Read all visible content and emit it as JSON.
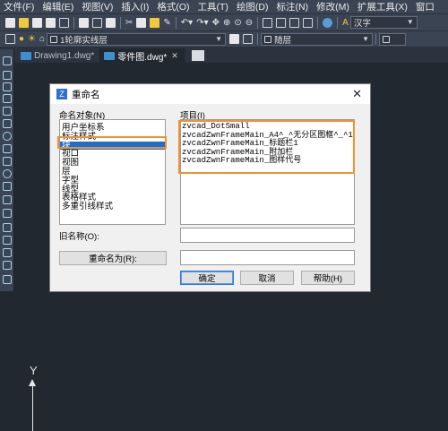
{
  "menu": [
    "文件(F)",
    "编辑(E)",
    "视图(V)",
    "插入(I)",
    "格式(O)",
    "工具(T)",
    "绘图(D)",
    "标注(N)",
    "修改(M)",
    "扩展工具(X)",
    "窗口"
  ],
  "toolbar": {
    "font_combo": "汉字",
    "layer_combo": "1轮廓实线层",
    "layer_right_combo": "随层"
  },
  "tabs": [
    {
      "label": "Drawing1.dwg*",
      "active": false
    },
    {
      "label": "零件图.dwg*",
      "active": true
    }
  ],
  "dialog": {
    "title": "重命名",
    "objects_label": "命名对象(N)",
    "items_label": "项目(I)",
    "named_objects": [
      "用户坐标系",
      "标注样式",
      "块",
      "视口",
      "视图",
      "层",
      "字型",
      "线型",
      "表格样式",
      "多重引线样式"
    ],
    "selected_object": "块",
    "items": [
      "zvcad_DotSmall",
      "zvcadZwnFrameMain_A4^_^无分区图框^_^1",
      "zvcadZwnFrameMain_标题栏1",
      "zvcadZwnFrameMain_附加栏",
      "zvcadZwnFrameMain_图样代号"
    ],
    "old_name_label": "旧名称(O):",
    "rename_to_button": "重命名为(R):",
    "ok_button": "确定",
    "cancel_button": "取消",
    "help_button": "帮助(H)",
    "highlight_color": "#f39130",
    "selection_color": "#1f6fd1"
  },
  "ucs": {
    "y_label": "Y"
  },
  "icons": [
    "new-icon",
    "open-icon",
    "save-icon",
    "print-icon",
    "cut-icon",
    "copy-icon",
    "paste-icon",
    "undo-icon",
    "redo-icon",
    "pan-icon",
    "zoom-icon",
    "close-icon"
  ]
}
